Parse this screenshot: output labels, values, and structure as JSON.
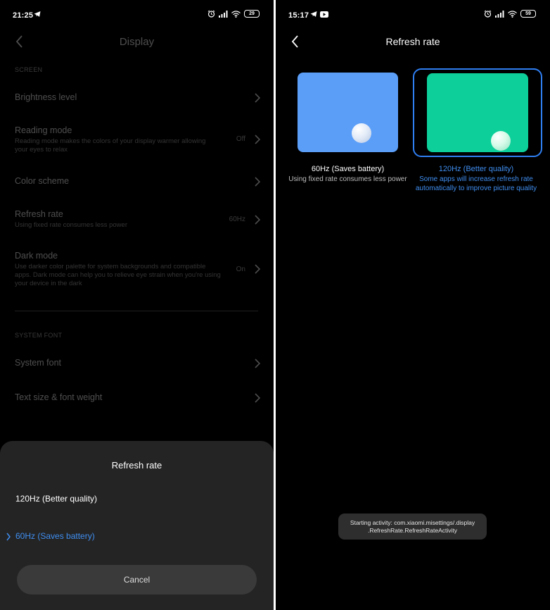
{
  "left": {
    "status": {
      "time": "21:25",
      "battery": "29"
    },
    "header": {
      "title": "Display"
    },
    "sections": {
      "screen": "SCREEN",
      "system_font": "SYSTEM FONT"
    },
    "items": {
      "brightness": {
        "title": "Brightness level"
      },
      "reading": {
        "title": "Reading mode",
        "subtitle_1": "Reading mode makes the colors of your display warmer allowing",
        "subtitle_2": "your eyes to relax",
        "value": "Off"
      },
      "color": {
        "title": "Color scheme"
      },
      "refresh": {
        "title": "Refresh rate",
        "subtitle_1": "Using fixed rate consumes less power",
        "value": "60Hz"
      },
      "dark": {
        "title": "Dark mode",
        "subtitle_1": "Use darker color palette for system backgrounds and compatible",
        "subtitle_2": "apps. Dark mode can help you to relieve eye strain when you're using",
        "subtitle_3": "your device in the dark",
        "value": "On"
      },
      "system_font": {
        "title": "System font"
      },
      "text_size": {
        "title": "Text size & font weight"
      }
    },
    "sheet": {
      "title": "Refresh rate",
      "option_120": "120Hz (Better quality)",
      "option_60": "60Hz (Saves battery)",
      "selected": "60Hz (Saves battery)",
      "cancel": "Cancel"
    }
  },
  "right": {
    "status": {
      "time": "15:17",
      "battery": "59"
    },
    "header": {
      "title": "Refresh rate"
    },
    "options": {
      "hz60": {
        "label": "60Hz (Saves battery)",
        "desc_1": "Using fixed rate consumes less power",
        "color": "#5b9ef8"
      },
      "hz120": {
        "label": "120Hz (Better quality)",
        "desc_1": "Some apps will increase refresh rate",
        "desc_2": "automatically to improve picture quality",
        "color": "#0ccf9a",
        "selected": true
      }
    },
    "toast": {
      "line_1": "Starting activity: com.xiaomi.misettings/.display",
      "line_2": ".RefreshRate.RefreshRateActivity"
    }
  },
  "colors": {
    "accent": "#3f8ef0",
    "selected_border": "#2f7ff2",
    "sheet_bg": "#242424"
  }
}
